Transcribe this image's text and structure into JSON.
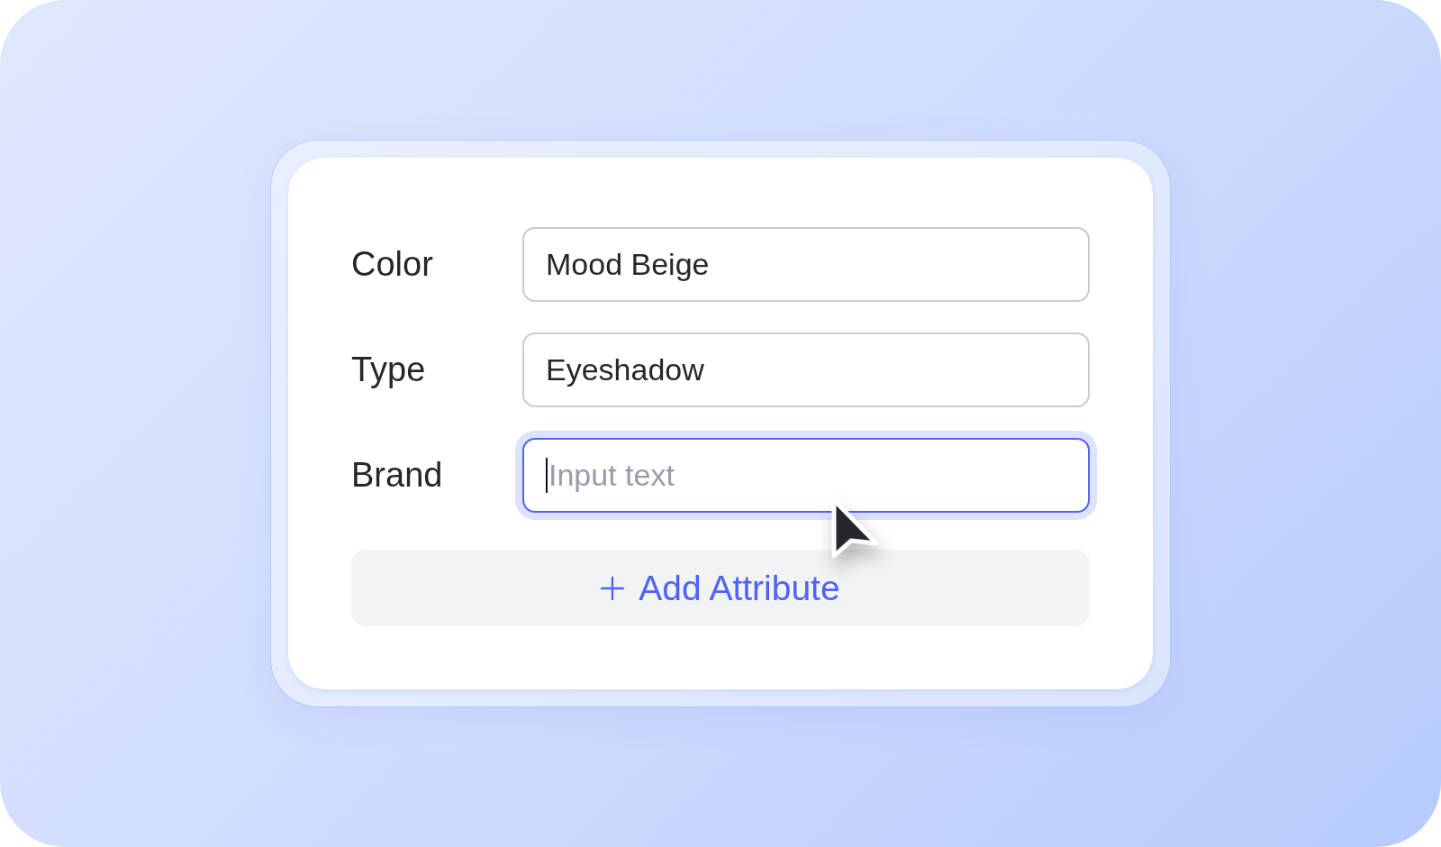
{
  "form": {
    "fields": [
      {
        "label": "Color",
        "value": "Mood Beige",
        "focused": false
      },
      {
        "label": "Type",
        "value": "Eyeshadow",
        "focused": false
      },
      {
        "label": "Brand",
        "placeholder": "Input text",
        "focused": true
      }
    ],
    "add_button": {
      "label": "Add Attribute"
    }
  }
}
